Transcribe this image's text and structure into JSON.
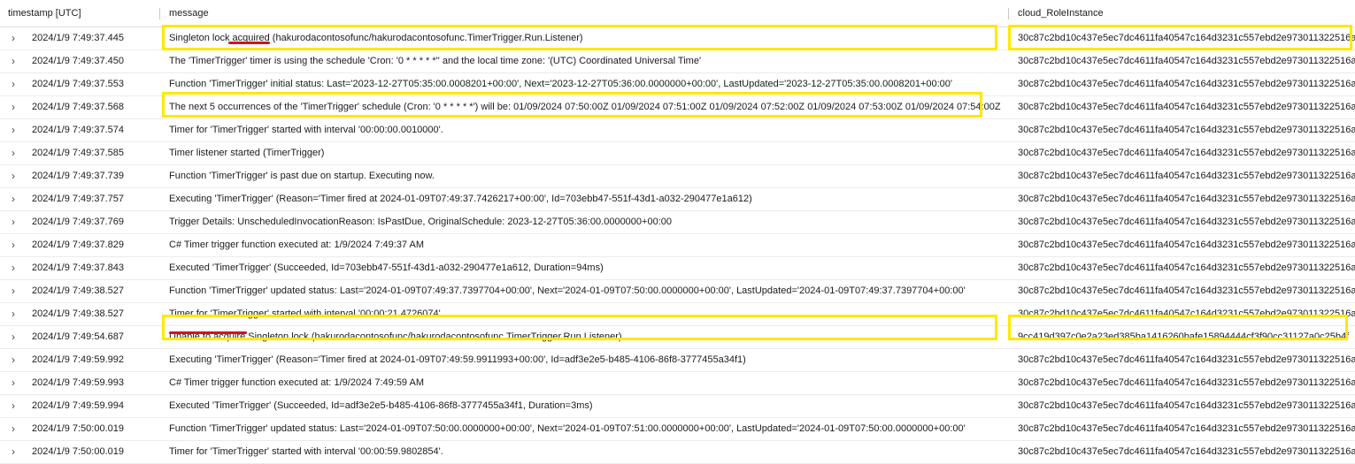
{
  "columns": {
    "timestamp": "timestamp [UTC]",
    "message": "message",
    "instance": "cloud_RoleInstance"
  },
  "icons": {
    "expand": "chevron-right-icon"
  },
  "highlight_color": "#ffe800",
  "underline_color": "#d4121e",
  "rows": [
    {
      "ts": "2024/1/9 7:49:37.445",
      "msg": "Singleton lock acquired (hakurodacontosofunc/hakurodacontosofunc.TimerTrigger.Run.Listener)",
      "inst": "30c87c2bd10c437e5ec7dc4611fa40547c164d3231c557ebd2e973011322516a"
    },
    {
      "ts": "2024/1/9 7:49:37.450",
      "msg": "The 'TimerTrigger' timer is using the schedule 'Cron: '0 * * * * *'' and the local time zone: '(UTC) Coordinated Universal Time'",
      "inst": "30c87c2bd10c437e5ec7dc4611fa40547c164d3231c557ebd2e973011322516a"
    },
    {
      "ts": "2024/1/9 7:49:37.553",
      "msg": "Function 'TimerTrigger' initial status: Last='2023-12-27T05:35:00.0008201+00:00', Next='2023-12-27T05:36:00.0000000+00:00', LastUpdated='2023-12-27T05:35:00.0008201+00:00'",
      "inst": "30c87c2bd10c437e5ec7dc4611fa40547c164d3231c557ebd2e973011322516a"
    },
    {
      "ts": "2024/1/9 7:49:37.568",
      "msg": "The next 5 occurrences of the 'TimerTrigger' schedule (Cron: '0 * * * * *') will be: 01/09/2024 07:50:00Z 01/09/2024 07:51:00Z 01/09/2024 07:52:00Z 01/09/2024 07:53:00Z 01/09/2024 07:54:00Z",
      "inst": "30c87c2bd10c437e5ec7dc4611fa40547c164d3231c557ebd2e973011322516a"
    },
    {
      "ts": "2024/1/9 7:49:37.574",
      "msg": "Timer for 'TimerTrigger' started with interval '00:00:00.0010000'.",
      "inst": "30c87c2bd10c437e5ec7dc4611fa40547c164d3231c557ebd2e973011322516a"
    },
    {
      "ts": "2024/1/9 7:49:37.585",
      "msg": "Timer listener started (TimerTrigger)",
      "inst": "30c87c2bd10c437e5ec7dc4611fa40547c164d3231c557ebd2e973011322516a"
    },
    {
      "ts": "2024/1/9 7:49:37.739",
      "msg": "Function 'TimerTrigger' is past due on startup. Executing now.",
      "inst": "30c87c2bd10c437e5ec7dc4611fa40547c164d3231c557ebd2e973011322516a"
    },
    {
      "ts": "2024/1/9 7:49:37.757",
      "msg": "Executing 'TimerTrigger' (Reason='Timer fired at 2024-01-09T07:49:37.7426217+00:00', Id=703ebb47-551f-43d1-a032-290477e1a612)",
      "inst": "30c87c2bd10c437e5ec7dc4611fa40547c164d3231c557ebd2e973011322516a"
    },
    {
      "ts": "2024/1/9 7:49:37.769",
      "msg": "Trigger Details: UnscheduledInvocationReason: IsPastDue, OriginalSchedule: 2023-12-27T05:36:00.0000000+00:00",
      "inst": "30c87c2bd10c437e5ec7dc4611fa40547c164d3231c557ebd2e973011322516a"
    },
    {
      "ts": "2024/1/9 7:49:37.829",
      "msg": "C# Timer trigger function executed at: 1/9/2024 7:49:37 AM",
      "inst": "30c87c2bd10c437e5ec7dc4611fa40547c164d3231c557ebd2e973011322516a"
    },
    {
      "ts": "2024/1/9 7:49:37.843",
      "msg": "Executed 'TimerTrigger' (Succeeded, Id=703ebb47-551f-43d1-a032-290477e1a612, Duration=94ms)",
      "inst": "30c87c2bd10c437e5ec7dc4611fa40547c164d3231c557ebd2e973011322516a"
    },
    {
      "ts": "2024/1/9 7:49:38.527",
      "msg": "Function 'TimerTrigger' updated status: Last='2024-01-09T07:49:37.7397704+00:00', Next='2024-01-09T07:50:00.0000000+00:00', LastUpdated='2024-01-09T07:49:37.7397704+00:00'",
      "inst": "30c87c2bd10c437e5ec7dc4611fa40547c164d3231c557ebd2e973011322516a"
    },
    {
      "ts": "2024/1/9 7:49:38.527",
      "msg": "Timer for 'TimerTrigger' started with interval '00:00:21.4726074'.",
      "inst": "30c87c2bd10c437e5ec7dc4611fa40547c164d3231c557ebd2e973011322516a"
    },
    {
      "ts": "2024/1/9 7:49:54.687",
      "msg": "Unable to acquire Singleton lock (hakurodacontosofunc/hakurodacontosofunc.TimerTrigger.Run.Listener).",
      "inst": "9cc419d397c0e2a23ed385ba1416260bafe15894444cf3f90cc31127a0c25b4f"
    },
    {
      "ts": "2024/1/9 7:49:59.992",
      "msg": "Executing 'TimerTrigger' (Reason='Timer fired at 2024-01-09T07:49:59.9911993+00:00', Id=adf3e2e5-b485-4106-86f8-3777455a34f1)",
      "inst": "30c87c2bd10c437e5ec7dc4611fa40547c164d3231c557ebd2e973011322516a"
    },
    {
      "ts": "2024/1/9 7:49:59.993",
      "msg": "C# Timer trigger function executed at: 1/9/2024 7:49:59 AM",
      "inst": "30c87c2bd10c437e5ec7dc4611fa40547c164d3231c557ebd2e973011322516a"
    },
    {
      "ts": "2024/1/9 7:49:59.994",
      "msg": "Executed 'TimerTrigger' (Succeeded, Id=adf3e2e5-b485-4106-86f8-3777455a34f1, Duration=3ms)",
      "inst": "30c87c2bd10c437e5ec7dc4611fa40547c164d3231c557ebd2e973011322516a"
    },
    {
      "ts": "2024/1/9 7:50:00.019",
      "msg": "Function 'TimerTrigger' updated status: Last='2024-01-09T07:50:00.0000000+00:00', Next='2024-01-09T07:51:00.0000000+00:00', LastUpdated='2024-01-09T07:50:00.0000000+00:00'",
      "inst": "30c87c2bd10c437e5ec7dc4611fa40547c164d3231c557ebd2e973011322516a"
    },
    {
      "ts": "2024/1/9 7:50:00.019",
      "msg": "Timer for 'TimerTrigger' started with interval '00:00:59.9802854'.",
      "inst": "30c87c2bd10c437e5ec7dc4611fa40547c164d3231c557ebd2e973011322516a"
    }
  ]
}
